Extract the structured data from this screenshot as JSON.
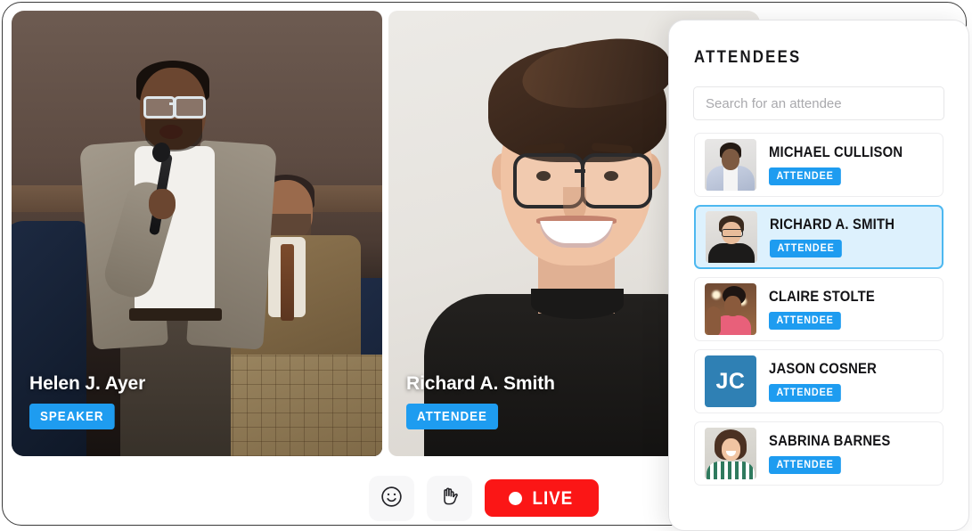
{
  "stage": {
    "tiles": [
      {
        "name": "Helen J. Ayer",
        "role": "SPEAKER",
        "avatar_kind": "speaker-photo"
      },
      {
        "name": "Richard A. Smith",
        "role": "ATTENDEE",
        "avatar_kind": "attendee-photo"
      }
    ]
  },
  "toolbar": {
    "reaction_icon": "smiley-face-icon",
    "raise_hand_icon": "raised-hand-icon",
    "live_label": "LIVE"
  },
  "panel": {
    "title": "ATTENDEES",
    "search": {
      "value": "",
      "placeholder": "Search for an attendee"
    },
    "attendees": [
      {
        "name": "MICHAEL CULLISON",
        "badge": "ATTENDEE",
        "avatar_type": "photo",
        "initials": "",
        "selected": false
      },
      {
        "name": "RICHARD A. SMITH",
        "badge": "ATTENDEE",
        "avatar_type": "photo",
        "initials": "",
        "selected": true
      },
      {
        "name": "CLAIRE STOLTE",
        "badge": "ATTENDEE",
        "avatar_type": "photo",
        "initials": "",
        "selected": false
      },
      {
        "name": "JASON COSNER",
        "badge": "ATTENDEE",
        "avatar_type": "initials",
        "initials": "JC",
        "selected": false
      },
      {
        "name": "SABRINA BARNES",
        "badge": "ATTENDEE",
        "avatar_type": "photo",
        "initials": "",
        "selected": false
      }
    ]
  },
  "colors": {
    "accent_blue": "#1e9cf0",
    "selected_bg": "#ddf1fd",
    "selected_border": "#4db8f0",
    "live_red": "#fb1616",
    "initials_avatar_bg": "#2f80b4"
  }
}
